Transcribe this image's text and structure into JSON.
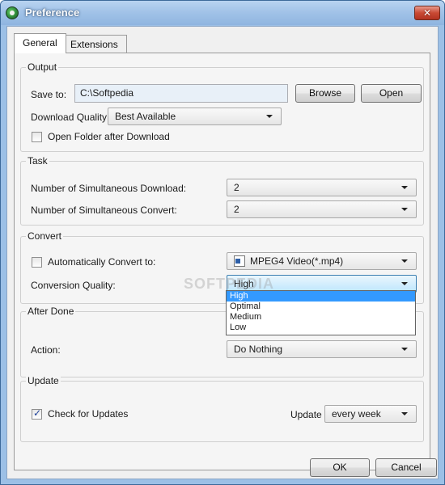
{
  "window": {
    "title": "Preference",
    "close_label": "✕"
  },
  "tabs": [
    {
      "label": "General"
    },
    {
      "label": "Extensions"
    }
  ],
  "output": {
    "legend": "Output",
    "save_to_label": "Save to:",
    "save_to_value": "C:\\Softpedia",
    "browse_label": "Browse",
    "open_label": "Open",
    "quality_label": "Download Quality:",
    "quality_value": "Best Available",
    "open_folder_label": "Open Folder after Download",
    "open_folder_checked": false
  },
  "task": {
    "legend": "Task",
    "sim_download_label": "Number of Simultaneous Download:",
    "sim_download_value": "2",
    "sim_convert_label": "Number of Simultaneous Convert:",
    "sim_convert_value": "2"
  },
  "convert": {
    "legend": "Convert",
    "auto_convert_label": "Automatically Convert to:",
    "auto_convert_checked": false,
    "format_value": "MPEG4 Video(*.mp4)",
    "quality_label": "Conversion Quality:",
    "quality_value": "High",
    "quality_options": [
      "High",
      "Optimal",
      "Medium",
      "Low"
    ],
    "quality_selected_index": 0
  },
  "after_done": {
    "legend": "After Done",
    "action_label": "Action:",
    "action_value": "Do Nothing"
  },
  "update": {
    "legend": "Update",
    "check_label": "Check for Updates",
    "check_checked": true,
    "update_label": "Update",
    "update_value": "every week"
  },
  "footer": {
    "ok_label": "OK",
    "cancel_label": "Cancel"
  },
  "watermark": "SOFTPEDIA",
  "colors": {
    "title_bar": "#9cc0e6",
    "selection": "#3399ff",
    "close": "#c94a34"
  },
  "icons": {
    "app": "app-globe-icon",
    "close": "close-icon",
    "format": "video-file-icon",
    "arrow": "chevron-down-icon"
  }
}
